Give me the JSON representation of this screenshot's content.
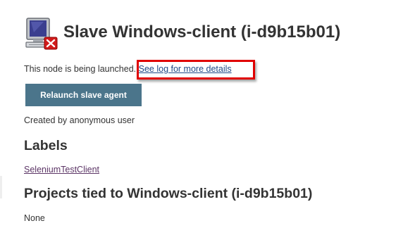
{
  "page": {
    "title": "Slave Windows-client (i-d9b15b01)",
    "status_text": "This node is being launched.",
    "log_link": "See log for more details",
    "relaunch_button": "Relaunch slave agent",
    "created_by": "Created by anonymous user"
  },
  "labels": {
    "heading": "Labels",
    "items": [
      "SeleniumTestClient"
    ]
  },
  "projects": {
    "heading": "Projects tied to Windows-client (i-d9b15b01)",
    "empty_text": "None"
  },
  "icons": {
    "node": "computer-offline-icon"
  },
  "colors": {
    "button_bg": "#4b758b",
    "highlight": "#e00000",
    "link": "#204a87",
    "visited_link": "#5c3566"
  }
}
